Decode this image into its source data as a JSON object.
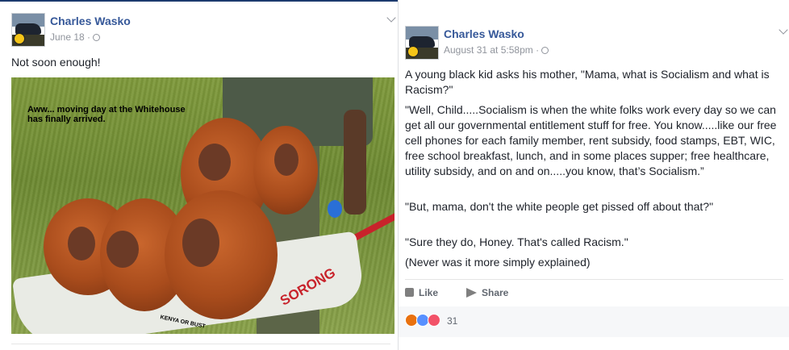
{
  "post_left": {
    "author": "Charles Wasko",
    "date": "June 18 ·",
    "text": "Not soon enough!",
    "image_caption_line1": "Aww... moving day at the Whitehouse",
    "image_caption_line2": "has finally arrived.",
    "wheelbarrow_brand": "SORONG",
    "wheelbarrow_tag": "KENYA OR BUST"
  },
  "post_right": {
    "author": "Charles Wasko",
    "date": "August 31 at 5:58pm ·",
    "paragraphs": [
      "A young black kid asks his mother, \"Mama, what is Socialism and what is Racism?\"",
      "\"Well, Child.....Socialism is when the white folks work every day so we can get all our governmental entitlement stuff for free. You know.....like our free cell phones for each family member, rent subsidy, food stamps, EBT, WIC, free school breakfast, lunch, and in some places supper; free healthcare, utility subsidy, and on and on.....you know, that’s Socialism.”",
      "\"But, mama, don't the white people get pissed off about that?\"",
      "\"Sure they do, Honey. That's called Racism.\"",
      "(Never was it more simply explained)"
    ],
    "like_label": "Like",
    "share_label": "Share",
    "reaction_count": "31",
    "reaction_colors": {
      "angry": "#e9710f",
      "like": "#5890ff",
      "love": "#f25268"
    }
  },
  "icons": [
    "globe-icon",
    "chevron-down-icon",
    "like-icon",
    "share-icon",
    "angry-reaction-icon",
    "like-reaction-icon",
    "love-reaction-icon"
  ],
  "colors": {
    "author_link": "#365899",
    "meta": "#90949c",
    "text": "#1d2129",
    "action": "#616770"
  }
}
